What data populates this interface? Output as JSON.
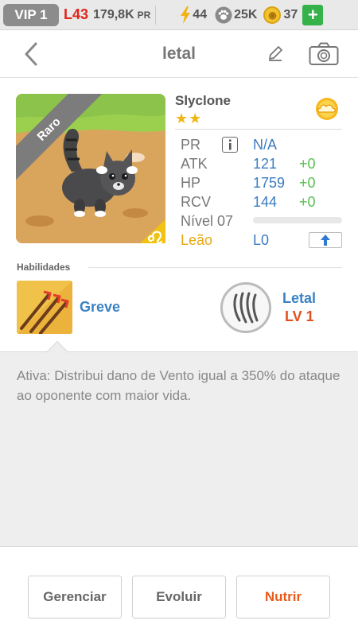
{
  "topbar": {
    "vip": "VIP 1",
    "level": "L43",
    "power": "179,8K",
    "power_unit": "PR",
    "energy": "44",
    "paw": "25K",
    "coins": "37",
    "plus": "+"
  },
  "nav": {
    "title": "letal"
  },
  "pet": {
    "rarity": "Raro",
    "name": "Slyclone",
    "stars": "★★",
    "stats": [
      {
        "label": "PR",
        "value": "N/A",
        "bonus": ""
      },
      {
        "label": "ATK",
        "value": "121",
        "bonus": "+0"
      },
      {
        "label": "HP",
        "value": "1759",
        "bonus": "+0"
      },
      {
        "label": "RCV",
        "value": "144",
        "bonus": "+0"
      }
    ],
    "level_label": "Nível 07",
    "xp_fraction": 0,
    "sign_label": "Leão",
    "sign_level": "L0"
  },
  "abilities": {
    "heading": "Habilidades",
    "active_name": "Greve",
    "passive_name": "Letal",
    "passive_level": "LV 1",
    "description": "Ativa: Distribui dano de Vento igual a 350% do ataque ao oponente com maior vida."
  },
  "buttons": {
    "manage": "Gerenciar",
    "evolve": "Evoluir",
    "feed": "Nutrir"
  },
  "colors": {
    "accent_blue": "#3a82c4",
    "bonus_green": "#5bbf52",
    "feed_orange": "#ea5a1b",
    "sign_gold": "#e7a813"
  }
}
